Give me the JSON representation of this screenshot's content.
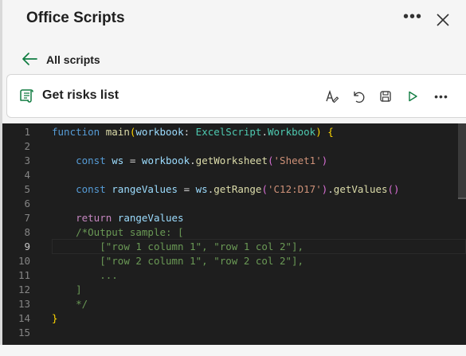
{
  "pane": {
    "title": "Office Scripts",
    "more_icon": "more-horizontal-icon",
    "close_icon": "close-icon"
  },
  "nav": {
    "back_label": "All scripts",
    "back_icon": "arrow-left-icon"
  },
  "script": {
    "name": "Get risks list",
    "icon": "script-scroll-icon",
    "toolbar": [
      "rename-icon",
      "undo-icon",
      "save-icon",
      "run-icon",
      "more-horizontal-icon"
    ]
  },
  "editor": {
    "active_line": 9,
    "lines": [
      {
        "n": "1",
        "tokens": [
          [
            "kw",
            "function"
          ],
          [
            "txt",
            " "
          ],
          [
            "fn",
            "main"
          ],
          [
            "br1",
            "("
          ],
          [
            "var",
            "workbook"
          ],
          [
            "txt",
            ": "
          ],
          [
            "ty",
            "ExcelScript"
          ],
          [
            "txt",
            "."
          ],
          [
            "ty",
            "Workbook"
          ],
          [
            "br1",
            ")"
          ],
          [
            "txt",
            " "
          ],
          [
            "br1",
            "{"
          ]
        ]
      },
      {
        "n": "2",
        "tokens": []
      },
      {
        "n": "3",
        "tokens": [
          [
            "txt",
            "    "
          ],
          [
            "kw",
            "const"
          ],
          [
            "txt",
            " "
          ],
          [
            "var",
            "ws"
          ],
          [
            "txt",
            " = "
          ],
          [
            "var",
            "workbook"
          ],
          [
            "txt",
            "."
          ],
          [
            "fn",
            "getWorksheet"
          ],
          [
            "br2",
            "("
          ],
          [
            "str",
            "'Sheet1'"
          ],
          [
            "br2",
            ")"
          ]
        ]
      },
      {
        "n": "4",
        "tokens": []
      },
      {
        "n": "5",
        "tokens": [
          [
            "txt",
            "    "
          ],
          [
            "kw",
            "const"
          ],
          [
            "txt",
            " "
          ],
          [
            "var",
            "rangeValues"
          ],
          [
            "txt",
            " = "
          ],
          [
            "var",
            "ws"
          ],
          [
            "txt",
            "."
          ],
          [
            "fn",
            "getRange"
          ],
          [
            "br2",
            "("
          ],
          [
            "str",
            "'C12:D17'"
          ],
          [
            "br2",
            ")"
          ],
          [
            "txt",
            "."
          ],
          [
            "fn",
            "getValues"
          ],
          [
            "br2",
            "()"
          ]
        ]
      },
      {
        "n": "6",
        "tokens": []
      },
      {
        "n": "7",
        "tokens": [
          [
            "txt",
            "    "
          ],
          [
            "ctl",
            "return"
          ],
          [
            "txt",
            " "
          ],
          [
            "var",
            "rangeValues"
          ]
        ]
      },
      {
        "n": "8",
        "tokens": [
          [
            "txt",
            "    "
          ],
          [
            "cmt",
            "/*Output sample: ["
          ]
        ]
      },
      {
        "n": "9",
        "tokens": [
          [
            "txt",
            "    "
          ],
          [
            "cmt",
            "    [\"row 1 column 1\", \"row 1 col 2\"],"
          ]
        ]
      },
      {
        "n": "10",
        "tokens": [
          [
            "txt",
            "    "
          ],
          [
            "cmt",
            "    [\"row 2 column 1\", \"row 2 col 2\"],"
          ]
        ]
      },
      {
        "n": "11",
        "tokens": [
          [
            "txt",
            "    "
          ],
          [
            "cmt",
            "    ..."
          ]
        ]
      },
      {
        "n": "12",
        "tokens": [
          [
            "txt",
            "    "
          ],
          [
            "cmt",
            "]"
          ]
        ]
      },
      {
        "n": "13",
        "tokens": [
          [
            "txt",
            "    "
          ],
          [
            "cmt",
            "*/"
          ]
        ]
      },
      {
        "n": "14",
        "tokens": [
          [
            "br1",
            "}"
          ]
        ]
      },
      {
        "n": "15",
        "tokens": []
      }
    ]
  },
  "colors": {
    "accent_green": "#107c41",
    "editor_bg": "#1e1e1e"
  }
}
